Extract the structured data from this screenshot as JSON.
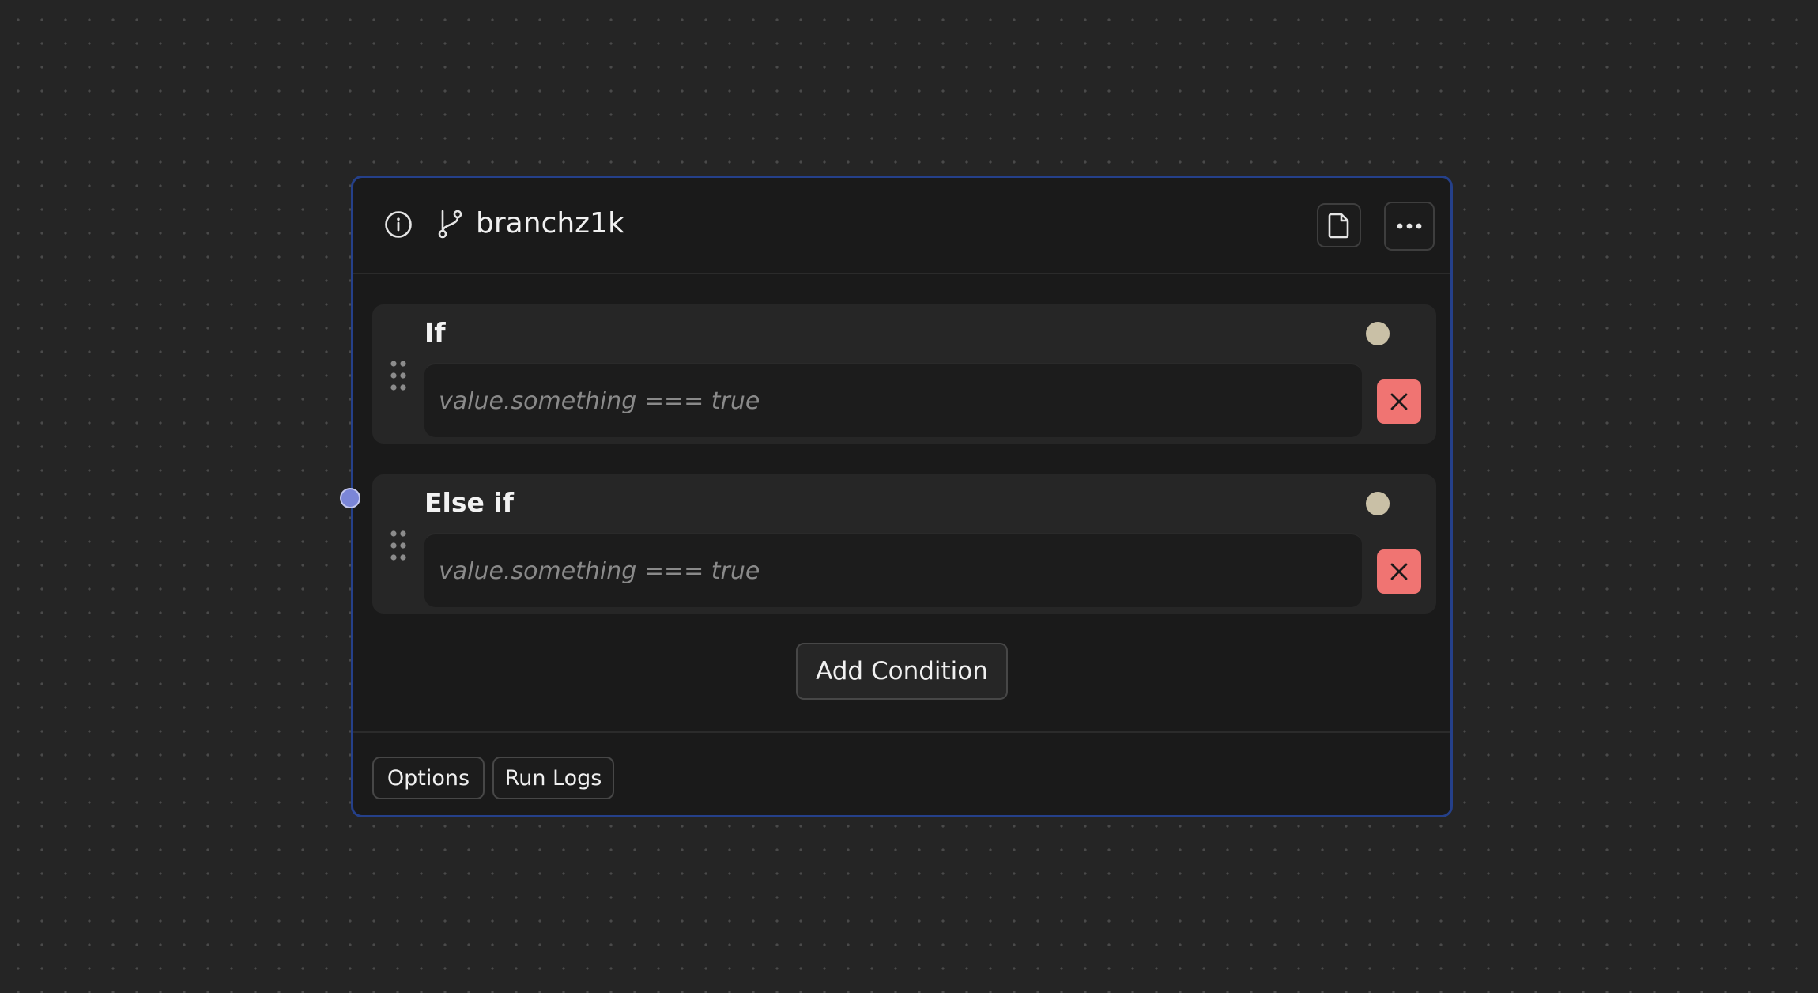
{
  "node": {
    "title": "branchz1k",
    "icons": {
      "info": "info-icon",
      "branch": "git-branch-icon",
      "document": "document-icon",
      "more": "ellipsis-icon",
      "drag": "drag-handle-icon",
      "remove": "close-icon"
    },
    "conditions": [
      {
        "label": "If",
        "placeholder": "value.something === true",
        "value": ""
      },
      {
        "label": "Else if",
        "placeholder": "value.something === true",
        "value": ""
      }
    ],
    "add_condition_label": "Add Condition",
    "footer": {
      "options_label": "Options",
      "run_logs_label": "Run Logs"
    }
  },
  "colors": {
    "canvas_bg": "#252525",
    "node_border": "#25408a",
    "input_handle": "#7b86d8",
    "output_handle": "#c9c0a6",
    "remove_button": "#f07472"
  }
}
